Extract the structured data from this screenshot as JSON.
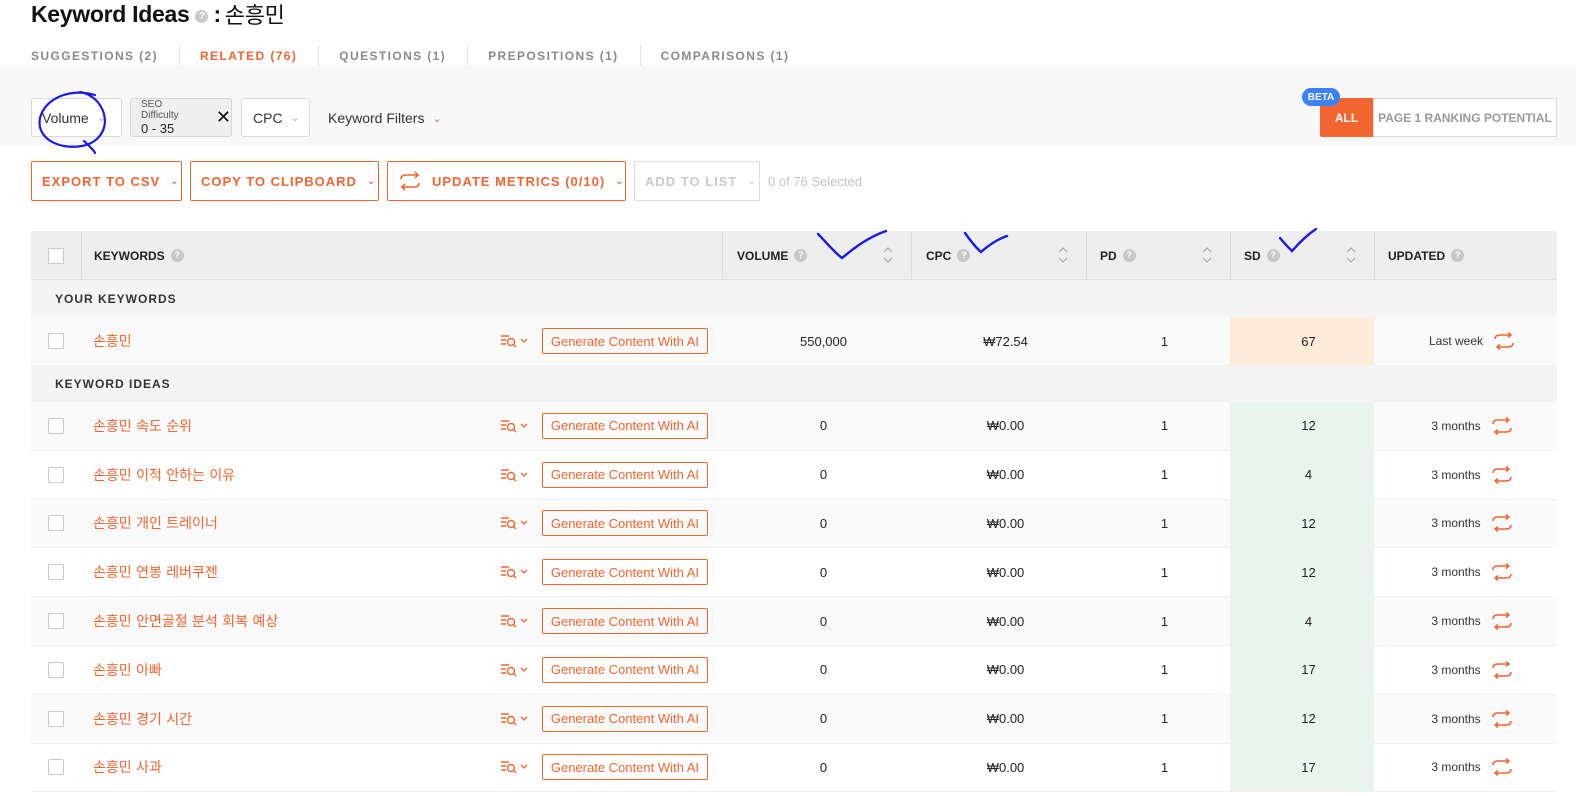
{
  "header": {
    "title": "Keyword Ideas",
    "help": "?",
    "colon": ":",
    "keyword": "손흥민"
  },
  "tabs": [
    {
      "label": "SUGGESTIONS (2)",
      "active": false
    },
    {
      "label": "RELATED (76)",
      "active": true
    },
    {
      "label": "QUESTIONS (1)",
      "active": false
    },
    {
      "label": "PREPOSITIONS (1)",
      "active": false
    },
    {
      "label": "COMPARISONS (1)",
      "active": false
    }
  ],
  "filters": {
    "volume": "Volume",
    "sd_label": "SEO Difficulty",
    "sd_value": "0 - 35",
    "sd_clear": "✕",
    "cpc": "CPC",
    "keyword_filters": "Keyword Filters",
    "beta": "BETA",
    "all": "ALL",
    "page1": "PAGE 1 RANKING POTENTIAL"
  },
  "actions": {
    "export": "EXPORT TO CSV",
    "copy": "COPY TO CLIPBOARD",
    "update": "UPDATE METRICS (0/10)",
    "add": "ADD TO LIST",
    "selected": "0 of 76 Selected"
  },
  "columns": {
    "keywords": "KEYWORDS",
    "volume": "VOLUME",
    "cpc": "CPC",
    "pd": "PD",
    "sd": "SD",
    "updated": "UPDATED"
  },
  "sections": {
    "yours": "YOUR KEYWORDS",
    "ideas": "KEYWORD IDEAS"
  },
  "generate_label": "Generate Content With AI",
  "your_keyword": {
    "keyword": "손흥민",
    "volume": "550,000",
    "cpc": "₩72.54",
    "pd": "1",
    "sd": "67",
    "updated": "Last week"
  },
  "rows": [
    {
      "keyword": "손흥민 속도 순위",
      "volume": "0",
      "cpc": "₩0.00",
      "pd": "1",
      "sd": "12",
      "updated": "3 months"
    },
    {
      "keyword": "손흥민 이적 안하는 이유",
      "volume": "0",
      "cpc": "₩0.00",
      "pd": "1",
      "sd": "4",
      "updated": "3 months"
    },
    {
      "keyword": "손흥민 개인 트레이너",
      "volume": "0",
      "cpc": "₩0.00",
      "pd": "1",
      "sd": "12",
      "updated": "3 months"
    },
    {
      "keyword": "손흥민 연봉 레버쿠젠",
      "volume": "0",
      "cpc": "₩0.00",
      "pd": "1",
      "sd": "12",
      "updated": "3 months"
    },
    {
      "keyword": "손흥민 안면골절 분석 회복 예상",
      "volume": "0",
      "cpc": "₩0.00",
      "pd": "1",
      "sd": "4",
      "updated": "3 months"
    },
    {
      "keyword": "손흥민 아빠",
      "volume": "0",
      "cpc": "₩0.00",
      "pd": "1",
      "sd": "17",
      "updated": "3 months"
    },
    {
      "keyword": "손흥민 경기 시간",
      "volume": "0",
      "cpc": "₩0.00",
      "pd": "1",
      "sd": "12",
      "updated": "3 months"
    },
    {
      "keyword": "손흥민 사과",
      "volume": "0",
      "cpc": "₩0.00",
      "pd": "1",
      "sd": "17",
      "updated": "3 months"
    }
  ],
  "colors": {
    "accent": "#f26430",
    "beta": "#3b82f6",
    "sd_green": "#e8f5ee",
    "sd_orange": "#fbebd8",
    "annotation": "#1a1ae6"
  }
}
